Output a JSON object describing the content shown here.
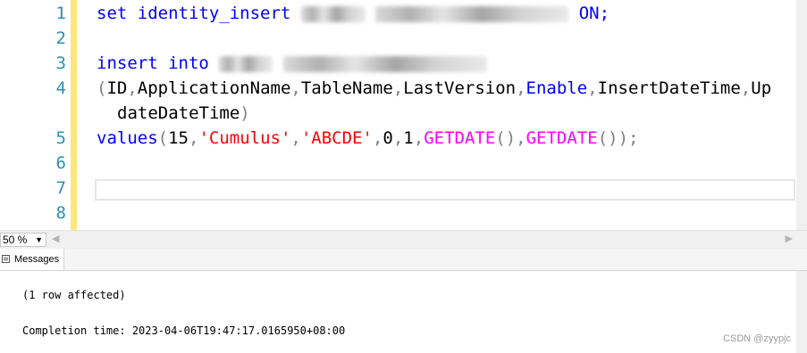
{
  "editor": {
    "line_numbers": [
      "1",
      "2",
      "3",
      "4",
      "",
      "5",
      "6",
      "7",
      "8"
    ],
    "line1": {
      "kw": "set identity_insert",
      "on": "ON;"
    },
    "line3": {
      "kw": "insert into"
    },
    "line4": {
      "open": "(",
      "cols": [
        "ID",
        "ApplicationName",
        "TableName",
        "LastVersion",
        "Enable",
        "InsertDateTime",
        "Up"
      ]
    },
    "line4b": {
      "text": "dateDateTime",
      "close": ")"
    },
    "line5": {
      "kw": "values",
      "open": "(",
      "n15": "15",
      "s1": "'Cumulus'",
      "s2": "'ABCDE'",
      "n0": "0",
      "n1": "1",
      "fn1": "GETDATE",
      "fn2": "GETDATE",
      "end": ");"
    }
  },
  "statusbar": {
    "zoom": "50 %"
  },
  "results": {
    "tab_label": "Messages",
    "row_affected": "(1 row affected)",
    "completion": "Completion time: 2023-04-06T19:47:17.0165950+08:00"
  },
  "watermark": "CSDN @zyypjc",
  "colors": {
    "keyword": "#0000ff",
    "string": "#ff0000",
    "function": "#ff00ff",
    "line_number": "#2b91af",
    "change_bar": "#fce77e"
  }
}
